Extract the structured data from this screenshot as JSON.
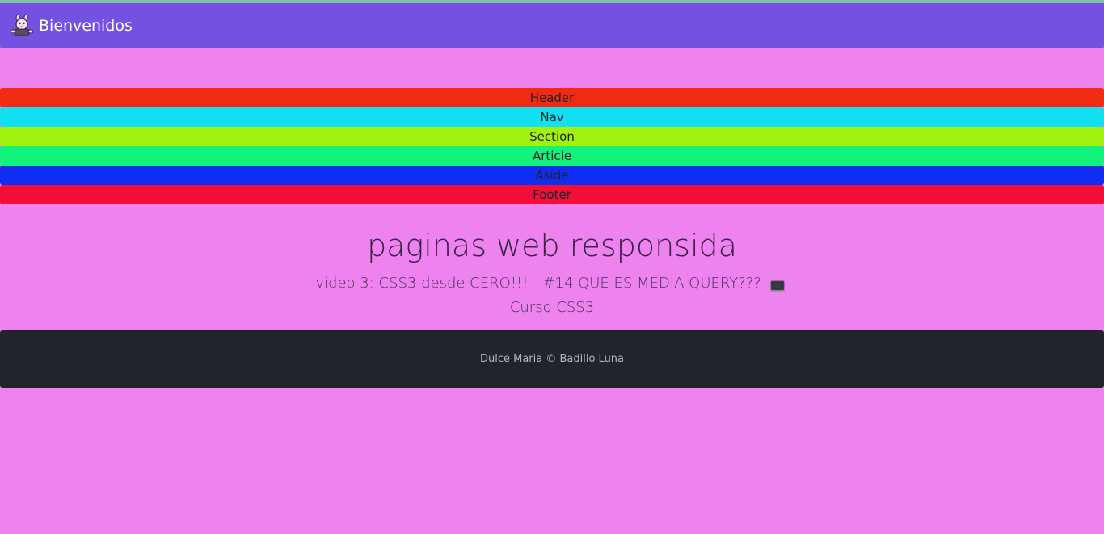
{
  "navbar": {
    "brand_text": "Bienvenidos",
    "brand_icon": "cartoon-character-icon",
    "background": "#7451e0"
  },
  "sections": [
    {
      "label": "Header",
      "color": "#f02b12"
    },
    {
      "label": "Nav",
      "color": "#10e0f2"
    },
    {
      "label": "Section",
      "color": "#a2f210"
    },
    {
      "label": "Article",
      "color": "#10f27a"
    },
    {
      "label": "Aside",
      "color": "#102ef2"
    },
    {
      "label": "Footer",
      "color": "#f20e36"
    }
  ],
  "main": {
    "title": "paginas web responsida",
    "subtitle_before_icon": "video 3: CSS3 desde CERO!!! - #14 QUE ES MEDIA QUERY???",
    "subtitle_icon": "laptop-icon",
    "subtitle_after_icon": "Curso CSS3"
  },
  "footer": {
    "text": "Dulce Maria © Badillo Luna",
    "background": "#212529"
  },
  "page_background": "#ee82ee"
}
